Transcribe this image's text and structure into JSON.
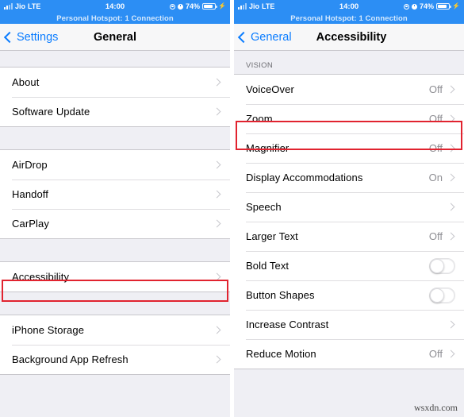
{
  "status_bar": {
    "signal_icon": "signal-bars-icon",
    "carrier": "Jio",
    "network": "LTE",
    "time": "14:00",
    "location_icon": "location-arrow-icon",
    "alarm_icon": "alarm-clock-icon",
    "battery_percent": "74%",
    "battery_icon": "battery-icon",
    "charging_icon": "lightning-bolt-icon"
  },
  "hotspot_banner": {
    "text": "Personal Hotspot: 1 Connection"
  },
  "colors": {
    "status_bar_blue": "#2c8ef4",
    "tint_blue": "#0a7cff",
    "highlight_red": "#e1232f",
    "group_background": "#efeff4",
    "value_gray": "#8e8e93"
  },
  "left_screen": {
    "nav": {
      "back_label": "Settings",
      "back_icon": "chevron-left-icon",
      "title": "General"
    },
    "groups": [
      {
        "rows": [
          {
            "label": "About",
            "value": "",
            "accessory": "chevron"
          },
          {
            "label": "Software Update",
            "value": "",
            "accessory": "chevron"
          }
        ]
      },
      {
        "rows": [
          {
            "label": "AirDrop",
            "value": "",
            "accessory": "chevron"
          },
          {
            "label": "Handoff",
            "value": "",
            "accessory": "chevron"
          },
          {
            "label": "CarPlay",
            "value": "",
            "accessory": "chevron"
          }
        ]
      },
      {
        "rows": [
          {
            "label": "Accessibility",
            "value": "",
            "accessory": "chevron",
            "highlighted": true
          }
        ]
      },
      {
        "rows": [
          {
            "label": "iPhone Storage",
            "value": "",
            "accessory": "chevron"
          },
          {
            "label": "Background App Refresh",
            "value": "",
            "accessory": "chevron"
          }
        ]
      }
    ]
  },
  "right_screen": {
    "nav": {
      "back_label": "General",
      "back_icon": "chevron-left-icon",
      "title": "Accessibility"
    },
    "section_header": "VISION",
    "rows": [
      {
        "label": "VoiceOver",
        "value": "Off",
        "accessory": "chevron"
      },
      {
        "label": "Zoom",
        "value": "Off",
        "accessory": "chevron",
        "highlighted": true
      },
      {
        "label": "Magnifier",
        "value": "Off",
        "accessory": "chevron"
      },
      {
        "label": "Display Accommodations",
        "value": "On",
        "accessory": "chevron"
      },
      {
        "label": "Speech",
        "value": "",
        "accessory": "chevron"
      },
      {
        "label": "Larger Text",
        "value": "Off",
        "accessory": "chevron"
      },
      {
        "label": "Bold Text",
        "value": "",
        "accessory": "toggle",
        "toggle_on": false
      },
      {
        "label": "Button Shapes",
        "value": "",
        "accessory": "toggle",
        "toggle_on": false
      },
      {
        "label": "Increase Contrast",
        "value": "",
        "accessory": "chevron"
      },
      {
        "label": "Reduce Motion",
        "value": "Off",
        "accessory": "chevron"
      }
    ]
  },
  "watermark": {
    "text": "wsxdn.com"
  }
}
